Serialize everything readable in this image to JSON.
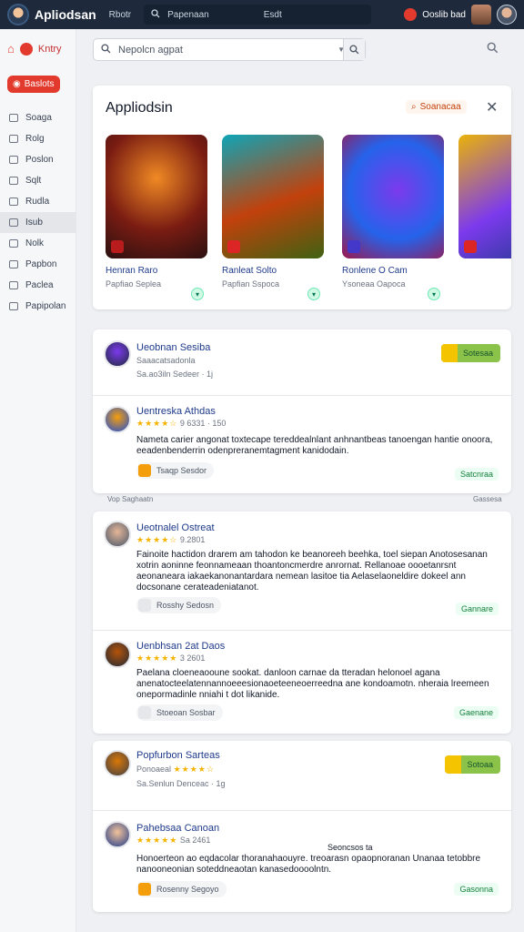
{
  "topbar": {
    "app_title": "Apliodsan",
    "link": "Rbotr",
    "search_text": "Papenaan",
    "search_sep": "Esdt",
    "right_text": "Ooslib bad"
  },
  "sidebar": {
    "brand": "Kntry",
    "active_pill": "Baslots",
    "items": [
      {
        "label": "Soaga",
        "icon": "list-icon"
      },
      {
        "label": "Rolg",
        "icon": "image-icon"
      },
      {
        "label": "Poslon",
        "icon": "grid-icon"
      },
      {
        "label": "Sqlt",
        "icon": "doc-icon"
      },
      {
        "label": "Rudla",
        "icon": "user-icon"
      },
      {
        "label": "Isub",
        "icon": "folder-icon"
      },
      {
        "label": "Nolk",
        "icon": "mail-icon"
      },
      {
        "label": "Papbon",
        "icon": "chart-icon"
      },
      {
        "label": "Paclea",
        "icon": "pin-icon"
      },
      {
        "label": "Papipolan",
        "icon": "settings-icon"
      }
    ]
  },
  "main_search": {
    "placeholder": "Nepolcn agpat"
  },
  "featured": {
    "title": "Appliodsin",
    "action_label": "Soanacaa",
    "cards": [
      {
        "name": "Henran Raro",
        "sub": "Papfiao Seplea",
        "colors": [
          "#7a1c12",
          "#f08a24",
          "#2a1010"
        ]
      },
      {
        "name": "Ranleat Solto",
        "sub": "Papfian Sspoca",
        "colors": [
          "#0ea5b7",
          "#c2410c",
          "#3f6212"
        ]
      },
      {
        "name": "Ronlene O Cam",
        "sub": "Ysoneaa Oapoca",
        "colors": [
          "#7c3aed",
          "#2563eb",
          "#9d174d"
        ]
      },
      {
        "name": "",
        "sub": "",
        "colors": [
          "#eab308",
          "#7c3aed",
          "#1e3a8a"
        ]
      }
    ]
  },
  "reviews_1": [
    {
      "name": "Ueobnan Sesiba",
      "meta": "Saaacatsadonla",
      "meta2": "Sa.ao3iln Sedeer · 1j",
      "follow": "Sotesaa"
    },
    {
      "name": "Uentreska Athdas",
      "stars": "★★★★☆",
      "date": "9 6331 · 150",
      "text": "Nameta carier angonat toxtecape tereddealnlant anhnantbeas tanoengan hantie onoora, eeadenbenderrin odenpreranemtagment kanidodain.",
      "chip": "Tsaqp Sesdor",
      "reply": "Satcnraa"
    }
  ],
  "fade_row": {
    "left": "Vop Saghaatn",
    "right": "Gassesa"
  },
  "reviews_2": [
    {
      "name": "Ueotnalel Ostreat",
      "stars": "★★★★☆",
      "date": "9.2801",
      "text": "Fainoite hactidon drarem am tahodon ke beanoreeh beehka, toel siepan Anotosesanan xotrin aoninne feonnameaan thoantoncmerdre anrornat. Rellanoae oooetanrsnt aeonaneara iakaekanonantardara nemean lasitoe tia Aelaselaoneldire dokeel ann docsonane cerateadeniatanot.",
      "chip": "Rosshy Sedosn",
      "reply": "Gannare"
    },
    {
      "name": "Uenbhsan 2at Daos",
      "stars": "★★★★★",
      "date": "3 2601",
      "text": "Paelana cloeneaooune sookat. danloon carnae da tteradan helonoel agana anenatocteelatennannoeeesionaoeteeneoerreedna ane kondoamotn. nheraia lreemeen onepormadinle nniahi t dot likanide.",
      "chip": "Stoeoan Sosbar",
      "reply": "Gaenane"
    }
  ],
  "reviews_3": [
    {
      "name": "Popfurbon Sarteas",
      "stars": "★★★★☆",
      "meta": "Ponoaeal",
      "meta2": "Sa.Senlun Denceac · 1g",
      "follow": "Sotoaa"
    },
    {
      "name": "Pahebsaa Canoan",
      "stars": "★★★★★",
      "date": "Sa 2461",
      "side_note": "Seoncsos ta",
      "text": "Honoerteon ao eqdacolar thoranahaouyre. treoarasn opaopnoranan Unanaa tetobbre nanooneonian soteddneaotan kanasedoooolntn.",
      "chip": "Rosenny Segoyo",
      "reply": "Gasonna"
    }
  ]
}
